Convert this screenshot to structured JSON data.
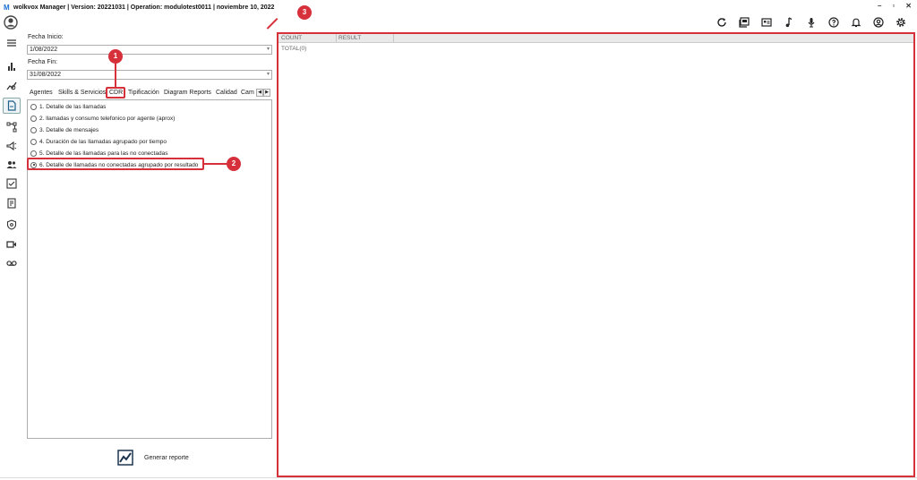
{
  "window": {
    "logo_text": "M",
    "title": "wolkvox Manager  | Version: 20221031  |  Operation: modulotest0011  |  noviembre 10, 2022",
    "controls": [
      "–",
      "▫",
      "✕"
    ]
  },
  "toolbar": {
    "icons": [
      "refresh-icon",
      "book-icon",
      "contact-card-icon",
      "music-note-icon",
      "microphone-icon",
      "help-icon",
      "bell-icon",
      "user-circle-icon",
      "settings-icon"
    ]
  },
  "sidebar": {
    "items": [
      "menu-icon",
      "bar-chart-icon",
      "analytics-icon",
      "document-icon",
      "flow-icon",
      "campaign-icon",
      "agents-icon",
      "checklist-icon",
      "report-icon",
      "shield-icon",
      "video-icon",
      "voicemail-icon"
    ],
    "active_index": 3
  },
  "filters": {
    "start_label": "Fecha Inicio:",
    "start_value": "1/08/2022",
    "end_label": "Fecha Fin:",
    "end_value": "31/08/2022"
  },
  "tabs": {
    "items": [
      "Agentes",
      "Skills & Servicios",
      "CDR",
      "Tipificación",
      "Diagram Reports",
      "Calidad",
      "Cam"
    ],
    "active": "CDR",
    "prev": "◀",
    "next": "▶"
  },
  "report_options": {
    "items": [
      "1. Detalle de las llamadas",
      "2. llamadas y consumo telefonico por agente (aprox)",
      "3. Detalle de mensajes",
      "4. Duración de las llamadas agrupado por tiempo",
      "5. Detalle de las llamadas para las no conectadas",
      "6. Detalle de llamadas no conectadas agrupado por resultado"
    ],
    "selected_index": 5
  },
  "generate_button": {
    "label": "Generar reporte"
  },
  "results": {
    "columns": [
      "COUNT",
      "RESULT"
    ],
    "total": "TOTAL(0)"
  },
  "annotations": {
    "badges": [
      "1",
      "2",
      "3"
    ],
    "color": "#d6303a"
  }
}
